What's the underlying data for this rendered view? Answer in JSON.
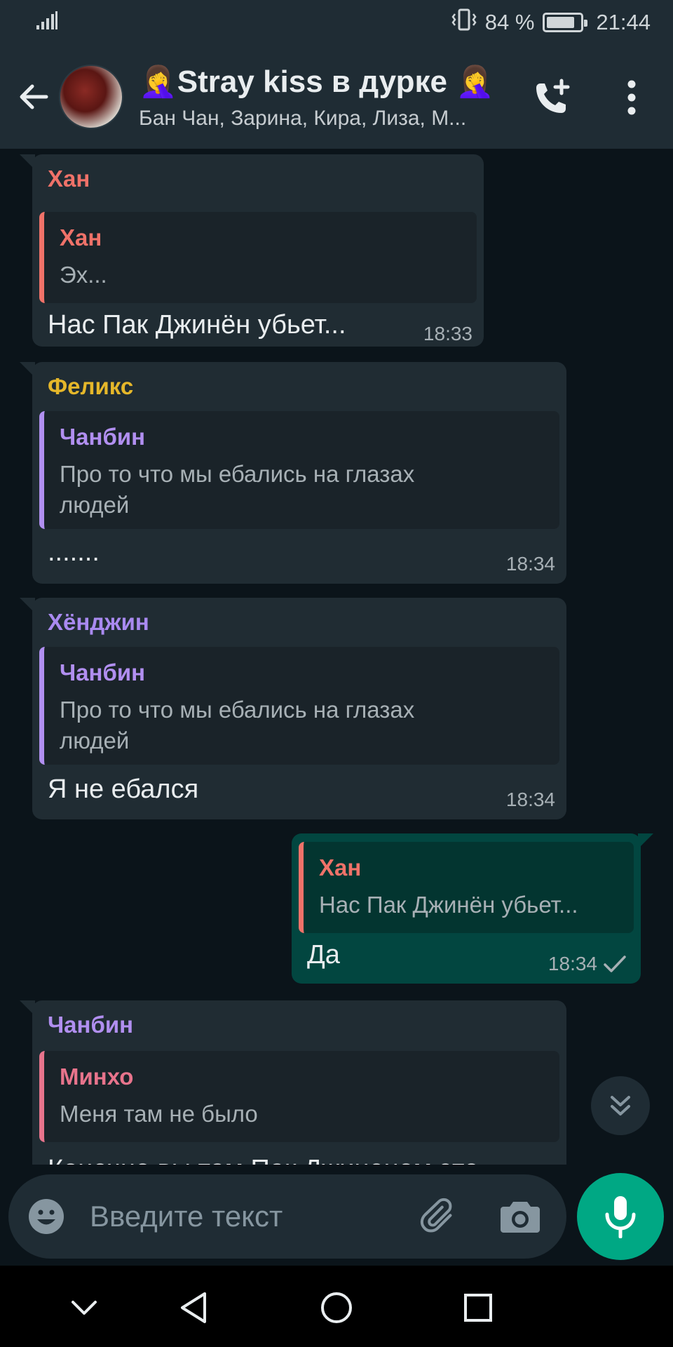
{
  "status": {
    "battery": "84 %",
    "battery_level": 0.84,
    "time": "21:44"
  },
  "header": {
    "title": "🤦‍♀️Stray kiss в дурке 🤦‍♀️",
    "subtitle": "Бан Чан, Зарина, Кира, Лиза, М..."
  },
  "messages": [
    {
      "sender": "Хан",
      "sender_color": "#f07269",
      "quote": {
        "name": "Хан",
        "name_color": "#f07269",
        "text": "Эх..."
      },
      "text": "Нас Пак Джинён убьет...",
      "time": "18:33"
    },
    {
      "sender": "Феликс",
      "sender_color": "#e5b72a",
      "quote": {
        "name": "Чанбин",
        "name_color": "#b18ff0",
        "text": "Про то что мы ебались на глазах людей"
      },
      "text": ".......",
      "time": "18:34"
    },
    {
      "sender": "Хёнджин",
      "sender_color": "#a98af0",
      "quote": {
        "name": "Чанбин",
        "name_color": "#b18ff0",
        "text": "Про то что мы ебались на глазах людей"
      },
      "text": "Я не ебался",
      "time": "18:34"
    },
    {
      "outgoing": true,
      "quote": {
        "name": "Хан",
        "name_color": "#f07269",
        "text": "Нас Пак Джинён убьет..."
      },
      "text": "Да",
      "time": "18:34"
    },
    {
      "sender": "Чанбин",
      "sender_color": "#b18ff0",
      "quote": {
        "name": "Минхо",
        "name_color": "#e8748c",
        "text": "Меня там не было"
      },
      "text": "Конечно вы там Пак Джиненом это"
    }
  ],
  "composer": {
    "placeholder": "Введите текст"
  },
  "colors": {
    "accent": "#00a884",
    "outgoing_bubble": "#024640",
    "incoming_bubble": "#202c33"
  }
}
